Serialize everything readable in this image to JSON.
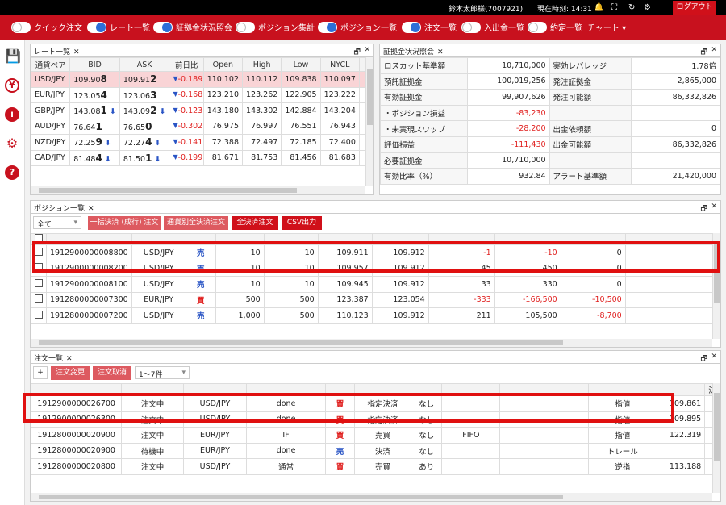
{
  "topbar": {
    "user": "鈴木太郎様(7007921)",
    "time_label": "現在時刻: 14:31",
    "logout": "ログアウト"
  },
  "toolbar": {
    "items": [
      {
        "label": "クイック注文",
        "on": false
      },
      {
        "label": "レート一覧",
        "on": true
      },
      {
        "label": "証拠金状況照会",
        "on": true
      },
      {
        "label": "ポジション集計",
        "on": false
      },
      {
        "label": "ポジション一覧",
        "on": true
      },
      {
        "label": "注文一覧",
        "on": true
      },
      {
        "label": "入出金一覧",
        "on": false
      },
      {
        "label": "約定一覧",
        "on": false
      }
    ],
    "chart": "チャート ▾"
  },
  "rates": {
    "title": "レート一覧",
    "headers": [
      "通貨ペア",
      "BID",
      "ASK",
      "前日比",
      "Open",
      "High",
      "Low",
      "NYCL",
      "最終"
    ],
    "rows": [
      {
        "pair": "USD/JPY",
        "bid": "109.90",
        "bid_p": "8",
        "ask": "109.91",
        "ask_p": "2",
        "arrow": "",
        "chg": "-0.189",
        "open": "110.102",
        "high": "110.112",
        "low": "109.838",
        "nycl": "110.097"
      },
      {
        "pair": "EUR/JPY",
        "bid": "123.05",
        "bid_p": "4",
        "ask": "123.06",
        "ask_p": "3",
        "arrow": "",
        "chg": "-0.168",
        "open": "123.210",
        "high": "123.262",
        "low": "122.905",
        "nycl": "123.222"
      },
      {
        "pair": "GBP/JPY",
        "bid": "143.08",
        "bid_p": "1",
        "ask": "143.09",
        "ask_p": "2",
        "arrow": "⬇",
        "chg": "-0.123",
        "open": "143.180",
        "high": "143.302",
        "low": "142.884",
        "nycl": "143.204"
      },
      {
        "pair": "AUD/JPY",
        "bid": "76.64",
        "bid_p": "1",
        "ask": "76.65",
        "ask_p": "0",
        "arrow": "",
        "chg": "-0.302",
        "open": "76.975",
        "high": "76.997",
        "low": "76.551",
        "nycl": "76.943"
      },
      {
        "pair": "NZD/JPY",
        "bid": "72.25",
        "bid_p": "9",
        "ask": "72.27",
        "ask_p": "4",
        "arrow": "⬇",
        "chg": "-0.141",
        "open": "72.388",
        "high": "72.497",
        "low": "72.185",
        "nycl": "72.400"
      },
      {
        "pair": "CAD/JPY",
        "bid": "81.48",
        "bid_p": "4",
        "ask": "81.50",
        "ask_p": "1",
        "arrow": "⬇",
        "chg": "-0.199",
        "open": "81.671",
        "high": "81.753",
        "low": "81.456",
        "nycl": "81.683"
      }
    ]
  },
  "margin": {
    "title": "証拠金状況照会",
    "rows": [
      [
        "ロスカット基準額",
        "10,710,000",
        "実効レバレッジ",
        "1.78倍"
      ],
      [
        "預託証拠金",
        "100,019,256",
        "発注証拠金",
        "2,865,000"
      ],
      [
        "有効証拠金",
        "99,907,626",
        "発注可能額",
        "86,332,826"
      ],
      [
        "・ポジション損益",
        "-83,230",
        "",
        ""
      ],
      [
        "・未実現スワップ",
        "-28,200",
        "出金依頼額",
        "0"
      ],
      [
        "評価損益",
        "-111,430",
        "出金可能額",
        "86,332,826"
      ],
      [
        "必要証拠金",
        "10,710,000",
        "",
        ""
      ],
      [
        "有効比率（%）",
        "932.84",
        "アラート基準額",
        "21,420,000"
      ]
    ]
  },
  "positions": {
    "title": "ポジション一覧",
    "filter": "全て",
    "buttons": [
      "一括決済 (成行) 注文",
      "通貨別全決済注文",
      "全決済注文",
      "CSV出力"
    ],
    "rows": [
      [
        "1912900000008800",
        "USD/JPY",
        "売",
        "10",
        "10",
        "109.911",
        "109.912",
        "-1",
        "-10",
        "0"
      ],
      [
        "1912900000008200",
        "USD/JPY",
        "売",
        "10",
        "10",
        "109.957",
        "109.912",
        "45",
        "450",
        "0"
      ],
      [
        "1912900000008100",
        "USD/JPY",
        "売",
        "10",
        "10",
        "109.945",
        "109.912",
        "33",
        "330",
        "0"
      ],
      [
        "1912800000007300",
        "EUR/JPY",
        "買",
        "500",
        "500",
        "123.387",
        "123.054",
        "-333",
        "-166,500",
        "-10,500"
      ],
      [
        "1912800000007200",
        "USD/JPY",
        "売",
        "1,000",
        "500",
        "110.123",
        "109.912",
        "211",
        "105,500",
        "-8,700"
      ]
    ]
  },
  "orders": {
    "title": "注文一覧",
    "plus": "+",
    "buttons": [
      "注文変更",
      "注文取消"
    ],
    "range": "1～7件",
    "last_header": "決済pip差",
    "rows": [
      [
        "1912900000026700",
        "注文中",
        "USD/JPY",
        "done",
        "買",
        "指定決済",
        "なし",
        "",
        "",
        "指値",
        "109.861"
      ],
      [
        "1912900000026300",
        "注文中",
        "USD/JPY",
        "done",
        "買",
        "指定決済",
        "なし",
        "",
        "",
        "指値",
        "109.895"
      ],
      [
        "1912800000020900",
        "注文中",
        "EUR/JPY",
        "IF",
        "買",
        "売買",
        "なし",
        "FIFO",
        "",
        "指値",
        "122.319"
      ],
      [
        "1912800000020900",
        "待機中",
        "EUR/JPY",
        "done",
        "売",
        "決済",
        "なし",
        "",
        "",
        "トレール",
        ""
      ],
      [
        "1912800000020800",
        "注文中",
        "USD/JPY",
        "通常",
        "買",
        "売買",
        "あり",
        "",
        "",
        "逆指",
        "113.188"
      ]
    ]
  },
  "colors": {
    "brand": "#c8111e",
    "highlight": "#e01010",
    "negative": "#e0201f",
    "sell": "#2a55c5"
  }
}
